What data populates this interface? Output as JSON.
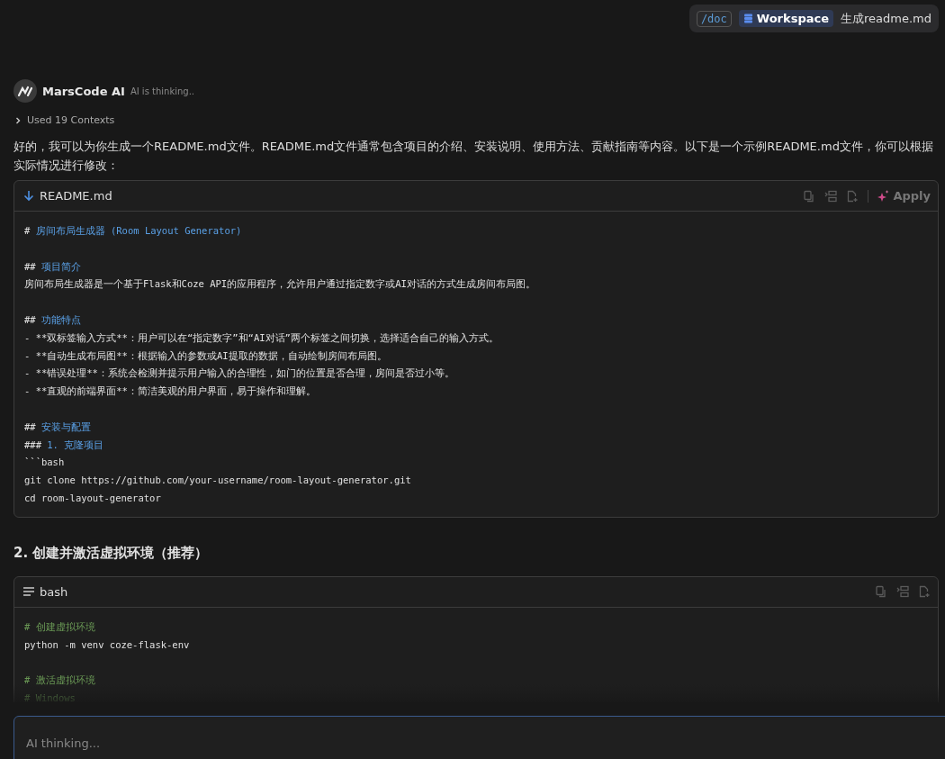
{
  "command_chip": {
    "command": "/doc",
    "scope": "Workspace",
    "prompt": "生成readme.md"
  },
  "assistant": {
    "name": "MarsCode AI",
    "status": "AI is thinking.."
  },
  "contexts": {
    "label": "Used 19 Contexts",
    "expanded": false
  },
  "intro": "好的，我可以为你生成一个README.md文件。README.md文件通常包含项目的介绍、安装说明、使用方法、贡献指南等内容。以下是一个示例README.md文件，你可以根据实际情况进行修改：",
  "blocks": [
    {
      "kind": "file",
      "title": "README.md",
      "apply": "Apply",
      "lines": [
        {
          "kind": "heading",
          "marker": "#",
          "text": "房间布局生成器 (Room Layout Generator)"
        },
        {
          "kind": "blank"
        },
        {
          "kind": "heading",
          "marker": "##",
          "text": "项目简介"
        },
        {
          "kind": "plain",
          "text": "房间布局生成器是一个基于Flask和Coze API的应用程序，允许用户通过指定数字或AI对话的方式生成房间布局图。"
        },
        {
          "kind": "blank"
        },
        {
          "kind": "heading",
          "marker": "##",
          "text": "功能特点"
        },
        {
          "kind": "plain",
          "text": "- **双标签输入方式**：用户可以在“指定数字”和“AI对话”两个标签之间切换，选择适合自己的输入方式。"
        },
        {
          "kind": "plain",
          "text": "- **自动生成布局图**：根据输入的参数或AI提取的数据，自动绘制房间布局图。"
        },
        {
          "kind": "plain",
          "text": "- **错误处理**：系统会检测并提示用户输入的合理性，如门的位置是否合理，房间是否过小等。"
        },
        {
          "kind": "plain",
          "text": "- **直观的前端界面**：简洁美观的用户界面，易于操作和理解。"
        },
        {
          "kind": "blank"
        },
        {
          "kind": "heading",
          "marker": "##",
          "text": "安装与配置"
        },
        {
          "kind": "heading",
          "marker": "###",
          "text": "1. 克隆项目"
        },
        {
          "kind": "plain",
          "text": "```bash"
        },
        {
          "kind": "plain",
          "text": "git clone https://github.com/your-username/room-layout-generator.git"
        },
        {
          "kind": "plain",
          "text": "cd room-layout-generator"
        }
      ]
    },
    {
      "kind": "heading",
      "title": "2. 创建并激活虚拟环境（推荐）"
    },
    {
      "kind": "shell",
      "title": "bash",
      "lines": [
        {
          "kind": "comment",
          "text": "# 创建虚拟环境"
        },
        {
          "kind": "plain",
          "text": "python -m venv coze-flask-env"
        },
        {
          "kind": "blank"
        },
        {
          "kind": "comment",
          "text": "# 激活虚拟环境"
        },
        {
          "kind": "comment",
          "text": "# Windows"
        }
      ]
    }
  ],
  "input": {
    "placeholder": "AI thinking..."
  }
}
